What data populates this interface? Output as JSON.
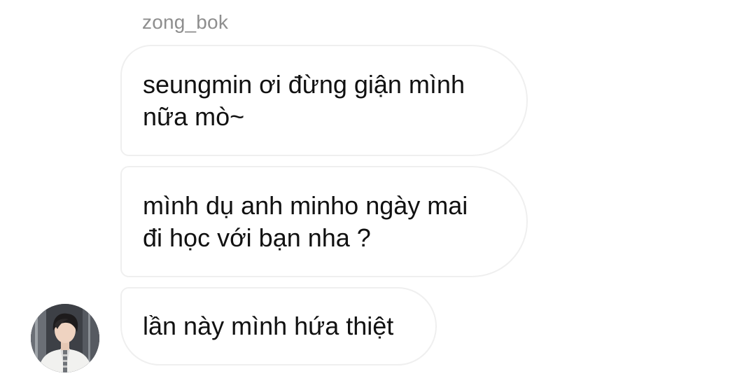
{
  "thread": {
    "sender": "zong_bok",
    "messages": [
      {
        "text": "seungmin ơi đừng giận mình\nnữa mò~"
      },
      {
        "text": "mình dụ anh minho ngày mai\nđi học với bạn nha ?"
      },
      {
        "text": "lần này mình hứa thiệt"
      }
    ],
    "avatar_icon": "profile-photo"
  },
  "colors": {
    "background": "#ffffff",
    "bubble_border": "#efefef",
    "sender_text": "#8e8e8e",
    "message_text": "#111111"
  }
}
